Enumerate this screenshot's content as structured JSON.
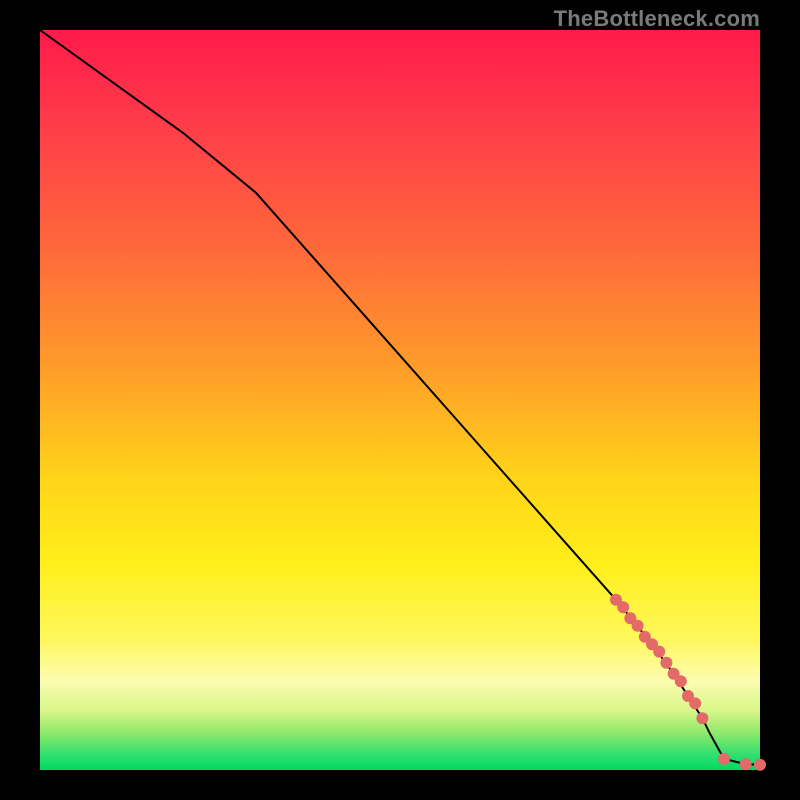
{
  "watermark": "TheBottleneck.com",
  "colors": {
    "line": "#000000",
    "points": "#e46a6a",
    "gradient_top": "#ff1a4a",
    "gradient_bottom": "#00d860"
  },
  "chart_data": {
    "type": "line",
    "title": "",
    "xlabel": "",
    "ylabel": "",
    "xlim": [
      0,
      100
    ],
    "ylim": [
      0,
      100
    ],
    "grid": false,
    "legend": false,
    "series": [
      {
        "name": "curve",
        "x": [
          0,
          10,
          20,
          30,
          40,
          50,
          60,
          70,
          80,
          85,
          88,
          90,
          92,
          93,
          95,
          98,
          100
        ],
        "y": [
          100,
          93,
          86,
          78,
          67,
          56,
          45,
          34,
          23,
          17,
          13,
          10,
          7,
          5,
          1.5,
          0.8,
          0.7
        ]
      }
    ],
    "points": {
      "name": "highlighted-points",
      "x": [
        80,
        81,
        82,
        83,
        84,
        85,
        86,
        87,
        88,
        89,
        90,
        91,
        92,
        95,
        98,
        100
      ],
      "y": [
        23,
        22,
        20.5,
        19.5,
        18,
        17,
        16,
        14.5,
        13,
        12,
        10,
        9,
        7,
        1.5,
        0.8,
        0.7
      ],
      "r": 6
    }
  }
}
